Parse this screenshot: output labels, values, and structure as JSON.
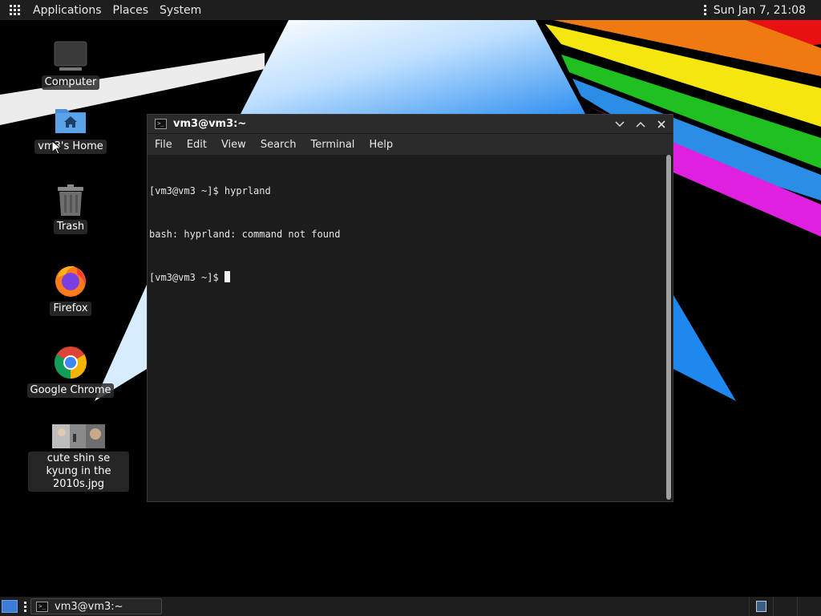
{
  "top_panel": {
    "menus": [
      "Applications",
      "Places",
      "System"
    ],
    "clock": "Sun Jan  7, 21:08"
  },
  "desktop": {
    "icons": [
      {
        "label": "Computer",
        "icon": "computer-icon"
      },
      {
        "label": "vm3's Home",
        "icon": "home-folder-icon"
      },
      {
        "label": "Trash",
        "icon": "trash-icon"
      },
      {
        "label": "Firefox",
        "icon": "firefox-icon"
      },
      {
        "label": "Google Chrome",
        "icon": "chrome-icon"
      },
      {
        "label": "cute shin se kyung in the 2010s.jpg",
        "icon": "image-thumbnail"
      }
    ]
  },
  "terminal": {
    "title": "vm3@vm3:~",
    "menu": [
      "File",
      "Edit",
      "View",
      "Search",
      "Terminal",
      "Help"
    ],
    "lines": [
      "[vm3@vm3 ~]$ hyprland",
      "bash: hyprland: command not found",
      "[vm3@vm3 ~]$ "
    ]
  },
  "taskbar": {
    "window_label": "vm3@vm3:~"
  },
  "colors": {
    "panel_bg": "#1e1e1e",
    "terminal_bg": "#1c1c1c",
    "accent_blue": "#3b7dd8"
  }
}
